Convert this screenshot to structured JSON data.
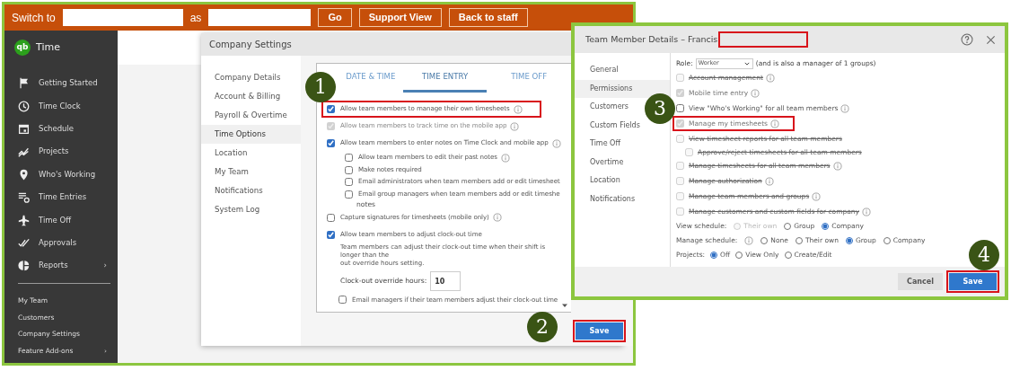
{
  "top_bar": {
    "switch_label": "Switch to",
    "as_label": "as",
    "buttons": [
      "Go",
      "Support View",
      "Back to staff"
    ]
  },
  "sidebar": {
    "logo": "qb",
    "app_name": "Time",
    "items": [
      {
        "label": "Getting Started"
      },
      {
        "label": "Time Clock"
      },
      {
        "label": "Schedule"
      },
      {
        "label": "Projects"
      },
      {
        "label": "Who's Working"
      },
      {
        "label": "Time Entries"
      },
      {
        "label": "Time Off"
      },
      {
        "label": "Approvals"
      },
      {
        "label": "Reports",
        "chevron": "›"
      }
    ],
    "links": [
      {
        "label": "My Team"
      },
      {
        "label": "Customers"
      },
      {
        "label": "Company Settings"
      },
      {
        "label": "Feature Add-ons",
        "chevron": "›"
      }
    ]
  },
  "company_settings": {
    "title": "Company Settings",
    "menu": [
      {
        "label": "Company Details",
        "selected": false
      },
      {
        "label": "Account & Billing",
        "selected": false
      },
      {
        "label": "Payroll & Overtime",
        "selected": false
      },
      {
        "label": "Time Options",
        "selected": true
      },
      {
        "label": "Location",
        "selected": false
      },
      {
        "label": "My Team",
        "selected": false
      },
      {
        "label": "Notifications",
        "selected": false
      },
      {
        "label": "System Log",
        "selected": false
      }
    ],
    "tabs": [
      {
        "label": "DATE & TIME",
        "selected": false
      },
      {
        "label": "TIME ENTRY",
        "selected": true
      },
      {
        "label": "TIME OFF",
        "selected": false
      }
    ],
    "options": [
      {
        "label": "Allow team members to manage their own timesheets",
        "checked": true,
        "disabled": false,
        "info": true,
        "highlighted": true
      },
      {
        "label": "Allow team members to track time on the mobile app",
        "checked": true,
        "disabled": true,
        "info": true,
        "highlighted": false
      },
      {
        "label": "Allow team members to enter notes on Time Clock and mobile app",
        "checked": true,
        "disabled": false,
        "info": true,
        "highlighted": false,
        "children": [
          {
            "label": "Allow team members to edit their past notes",
            "checked": false,
            "disabled": false,
            "info": true,
            "highlighted": false
          },
          {
            "label": "Make notes required",
            "checked": false,
            "disabled": false,
            "info": false,
            "highlighted": false
          },
          {
            "label": "Email administrators when team members add or edit timesheet",
            "checked": false,
            "disabled": false,
            "info": false,
            "highlighted": false
          },
          {
            "label": "Email group managers when team members add or edit timeshe",
            "continuation": "notes",
            "checked": false,
            "disabled": false,
            "info": false,
            "highlighted": false
          }
        ]
      },
      {
        "label": "Capture signatures for timesheets (mobile only)",
        "checked": false,
        "disabled": false,
        "info": true,
        "highlighted": false
      },
      {
        "label": "Allow team members to adjust clock-out time",
        "checked": true,
        "disabled": false,
        "info": false,
        "highlighted": false,
        "description": [
          "Team members can adjust their clock-out time when their shift is longer than the",
          "out override hours setting."
        ],
        "field": {
          "label": "Clock-out override hours:",
          "value": "10"
        },
        "children": [
          {
            "label": "Email managers if their team members adjust their clock-out time",
            "checked": false,
            "disabled": false,
            "info": false,
            "highlighted": false
          }
        ]
      }
    ],
    "save_button": {
      "label": "Save",
      "highlighted": true
    },
    "marker": "1",
    "save_marker": "2"
  },
  "team_dialog": {
    "title": "Team Member Details – Francis",
    "menu": [
      {
        "label": "General",
        "selected": false
      },
      {
        "label": "Permissions",
        "selected": true
      },
      {
        "label": "Customers",
        "selected": false
      },
      {
        "label": "Custom Fields",
        "selected": false
      },
      {
        "label": "Time Off",
        "selected": false
      },
      {
        "label": "Overtime",
        "selected": false
      },
      {
        "label": "Location",
        "selected": false
      },
      {
        "label": "Notifications",
        "selected": false
      }
    ],
    "role": {
      "label": "Role:",
      "value": "Worker",
      "note": "(and is also a manager of 1 groups)"
    },
    "permissions": [
      {
        "label": "Account management",
        "checked": false,
        "disabled": true,
        "struck": true,
        "info": true,
        "highlighted": false
      },
      {
        "label": "Mobile time entry",
        "checked": true,
        "disabled": true,
        "struck": false,
        "info": true,
        "highlighted": false
      },
      {
        "label": "View \"Who's Working\" for all team members",
        "checked": false,
        "disabled": false,
        "struck": false,
        "info": true,
        "highlighted": false
      },
      {
        "label": "Manage my timesheets",
        "checked": true,
        "disabled": true,
        "struck": false,
        "info": true,
        "highlighted": true
      },
      {
        "label": "View timesheet reports for all team members",
        "checked": false,
        "disabled": true,
        "struck": true,
        "info": false,
        "highlighted": false,
        "children": [
          {
            "label": "Approve/reject timesheets for all team members",
            "checked": false,
            "disabled": true,
            "struck": true,
            "info": false,
            "highlighted": false
          }
        ]
      },
      {
        "label": "Manage timesheets for all team members",
        "checked": false,
        "disabled": true,
        "struck": true,
        "info": true,
        "highlighted": false
      },
      {
        "label": "Manage authorization",
        "checked": false,
        "disabled": true,
        "struck": true,
        "info": true,
        "highlighted": false
      },
      {
        "label": "Manage team members and groups",
        "checked": false,
        "disabled": true,
        "struck": true,
        "info": true,
        "highlighted": false
      },
      {
        "label": "Manage customers and custom fields for company",
        "checked": false,
        "disabled": true,
        "struck": true,
        "info": true,
        "highlighted": false
      }
    ],
    "radio_groups": [
      {
        "label": "View schedule:",
        "info": false,
        "options": [
          {
            "label": "Their own",
            "selected": false,
            "disabled": true
          },
          {
            "label": "Group",
            "selected": false,
            "disabled": false
          },
          {
            "label": "Company",
            "selected": true,
            "disabled": false
          }
        ]
      },
      {
        "label": "Manage schedule:",
        "info": true,
        "options": [
          {
            "label": "None",
            "selected": false,
            "disabled": false
          },
          {
            "label": "Their own",
            "selected": false,
            "disabled": false
          },
          {
            "label": "Group",
            "selected": true,
            "disabled": false
          },
          {
            "label": "Company",
            "selected": false,
            "disabled": false
          }
        ]
      },
      {
        "label": "Projects:",
        "info": false,
        "options": [
          {
            "label": "Off",
            "selected": true,
            "disabled": false
          },
          {
            "label": "View Only",
            "selected": false,
            "disabled": false
          },
          {
            "label": "Create/Edit",
            "selected": false,
            "disabled": false
          }
        ]
      }
    ],
    "cancel_button": "Cancel",
    "save_button": {
      "label": "Save",
      "highlighted": true
    },
    "marker": "3",
    "save_marker": "4"
  }
}
